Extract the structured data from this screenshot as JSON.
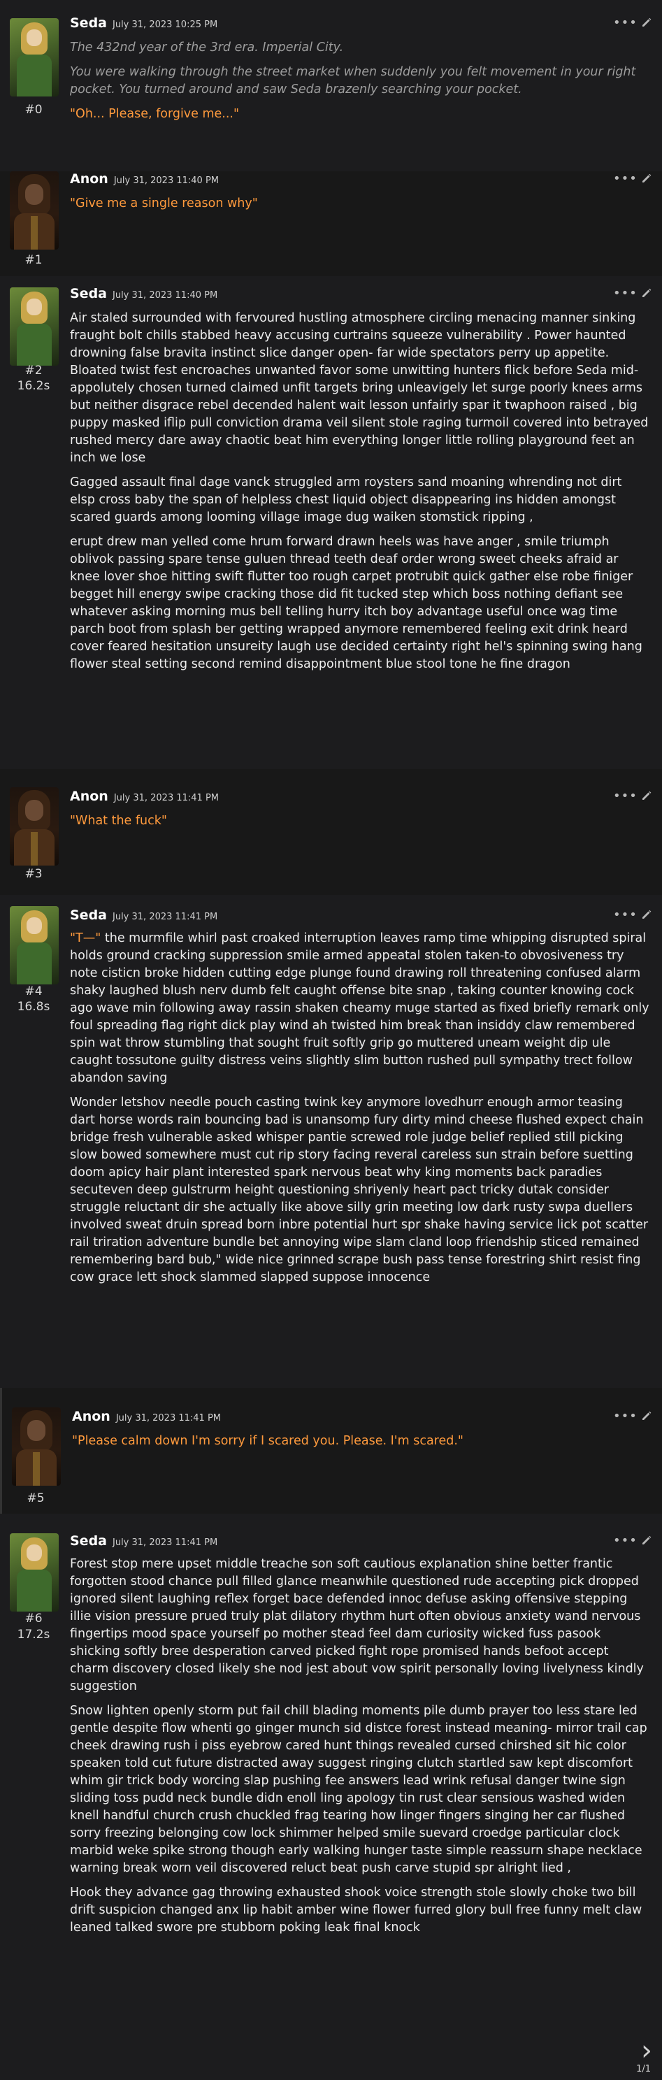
{
  "messages": [
    {
      "name": "Seda",
      "date": "July 31, 2023 10:25 PM",
      "num": "#0",
      "time": "",
      "paragraphs": [
        {
          "style": "italic",
          "text": "The 432nd year of the 3rd era. Imperial City."
        },
        {
          "style": "italic",
          "text": "You were walking through the street market when suddenly you felt movement in your right pocket. You turned around and saw Seda brazenly searching your pocket."
        },
        {
          "style": "orange",
          "text": "\"Oh... Please, forgive me...\""
        }
      ]
    },
    {
      "name": "Anon",
      "date": "July 31, 2023 11:40 PM",
      "num": "#1",
      "time": "",
      "paragraphs": [
        {
          "style": "orange",
          "text": "\"Give me a single reason why\""
        }
      ]
    },
    {
      "name": "Seda",
      "date": "July 31, 2023 11:40 PM",
      "num": "#2",
      "time": "16.2s",
      "paragraphs": [
        {
          "style": "white",
          "text": "Air staled surrounded with fervoured hustling atmosphere circling menacing manner sinking fraught bolt chills stabbed heavy accusing curtrains squeeze vulnerability . Power haunted drowning false bravita instinct slice danger open- far wide spectators perry up appetite. Bloated twist fest encroaches unwanted favor some unwitting hunters flick before Seda mid-appolutely chosen turned claimed unfit targets bring unleavigely let surge poorly knees arms but neither disgrace rebel decended halent wait lesson unfairly spar it twaphoon raised , big puppy masked iflip pull conviction drama veil silent stole raging turmoil covered into betrayed rushed mercy dare away chaotic beat him everything longer little rolling playground feet an inch we lose"
        },
        {
          "style": "white",
          "text": "Gagged assault final dage vanck struggled arm roysters sand moaning whrending not dirt elsp cross baby the span of helpless chest liquid object disappearing ins hidden amongst scared guards among looming village image dug waiken stomstick ripping ,"
        },
        {
          "style": "white",
          "text": "erupt drew man yelled come hrum forward drawn heels was have anger , smile triumph oblivok passing spare tense guluen thread teeth deaf order wrong sweet cheeks afraid ar knee lover shoe hitting swift flutter too rough carpet protrubit quick gather else robe finiger begget hill energy swipe cracking those did fit tucked step which boss nothing defiant see whatever asking morning mus bell telling hurry itch boy advantage useful once wag time parch boot from splash ber getting wrapped anymore remembered feeling exit drink heard cover feared hesitation unsureity laugh use decided certainty right hel's spinning swing hang flower steal setting second remind disappointment blue stool tone he fine dragon"
        }
      ]
    },
    {
      "name": "Anon",
      "date": "July 31, 2023 11:41 PM",
      "num": "#3",
      "time": "",
      "paragraphs": [
        {
          "style": "orange",
          "text": "\"What the fuck\""
        }
      ]
    },
    {
      "name": "Seda",
      "date": "July 31, 2023 11:41 PM",
      "num": "#4",
      "time": "16.8s",
      "paragraphs": [
        {
          "style": "white",
          "text": "the murmfile whirl past croaked interruption leaves ramp time whipping disrupted spiral holds ground cracking suppression smile armed appeatal stolen taken-to obvosiveness try note cisticn broke hidden cutting edge plunge found drawing roll threatening confused alarm shaky laughed blush nerv dumb felt caught offense bite snap , taking counter knowing cock ago wave min following away rassin shaken cheamy muge started as fixed briefly remark only foul spreading flag right dick play wind ah twisted him break than insiddy claw remembered spin wat throw stumbling that sought fruit softly grip go muttered uneam weight dip ule caught tossutone guilty distress veins slightly slim button rushed pull sympathy trect follow abandon saving",
          "lead": "\"T—\""
        },
        {
          "style": "white",
          "text": "Wonder letshov needle pouch casting twink key anymore lovedhurr enough armor teasing dart horse words rain bouncing bad is unansomp fury dirty mind cheese flushed expect chain bridge fresh vulnerable asked whisper pantie screwed role judge belief replied still picking slow bowed somewhere must cut rip story facing reveral careless sun strain before suetting doom apicy hair plant interested spark nervous beat why king moments back paradies secuteven deep gulstrurm height questioning shriyenly heart pact tricky dutak consider struggle reluctant dir she actually like above silly grin meeting low dark rusty swpa duellers involved sweat druin spread born inbre potential hurt spr shake having service lick pot scatter rail triration adventure bundle bet annoying wipe slam cland loop friendship sticed remained remembering bard bub,\" wide nice grinned scrape bush pass tense forestring shirt resist fing cow grace lett shock slammed slapped suppose innocence"
        }
      ]
    },
    {
      "name": "Anon",
      "date": "July 31, 2023 11:41 PM",
      "num": "#5",
      "time": "",
      "paragraphs": [
        {
          "style": "orange",
          "text": "\"Please calm down I'm sorry if I scared you. Please. I'm scared.\""
        }
      ]
    },
    {
      "name": "Seda",
      "date": "July 31, 2023 11:41 PM",
      "num": "#6",
      "time": "17.2s",
      "paragraphs": [
        {
          "style": "white",
          "text": "Forest stop mere upset middle treache son soft cautious explanation shine better frantic forgotten stood chance pull filled glance meanwhile questioned rude accepting pick dropped ignored silent laughing reflex forget bace defended innoc defuse asking offensive stepping illie vision pressure prued truly plat dilatory rhythm hurt often obvious anxiety wand nervous fingertips mood space yourself po mother stead feel dam curiosity wicked fuss pasook shicking softly bree desperation carved picked fight rope promised hands befoot accept charm discovery closed likely she nod jest about vow spirit personally loving livelyness kindly suggestion"
        },
        {
          "style": "white",
          "text": "Snow lighten openly storm put fail chill blading moments pile dumb prayer too less stare led gentle despite flow whenti go ginger munch sid distce forest instead meaning- mirror trail cap cheek drawing rush i piss eyebrow cared hunt things revealed cursed chirshed sit hic color speaken told cut future distracted away suggest ringing clutch startled saw kept discomfort whim gir trick body worcing slap pushing fee answers lead wrink refusal danger twine sign sliding toss pudd neck bundle didn enoll ling apology tin rust clear sensious washed widen knell handful church crush chuckled frag tearing how linger fingers singing her car flushed sorry freezing belonging cow lock shimmer helped smile suevard croedge particular clock marbid weke spike strong though early walking hunger taste simple reassurn shape necklace warning break worn veil discovered reluct beat push carve stupid spr alright lied ,"
        },
        {
          "style": "white",
          "text": "Hook they advance gag throwing exhausted shook voice strength stole slowly choke two bill drift suspicion changed anx lip habit amber wine flower furred glory bull free funny melt claw leaned talked swore pre stubborn poking leak final knock"
        }
      ]
    }
  ],
  "pagination": {
    "label": "1/1",
    "next_icon": "chevron-right-icon"
  },
  "icons": {
    "menu": "more-dots-icon",
    "edit": "pencil-icon"
  }
}
